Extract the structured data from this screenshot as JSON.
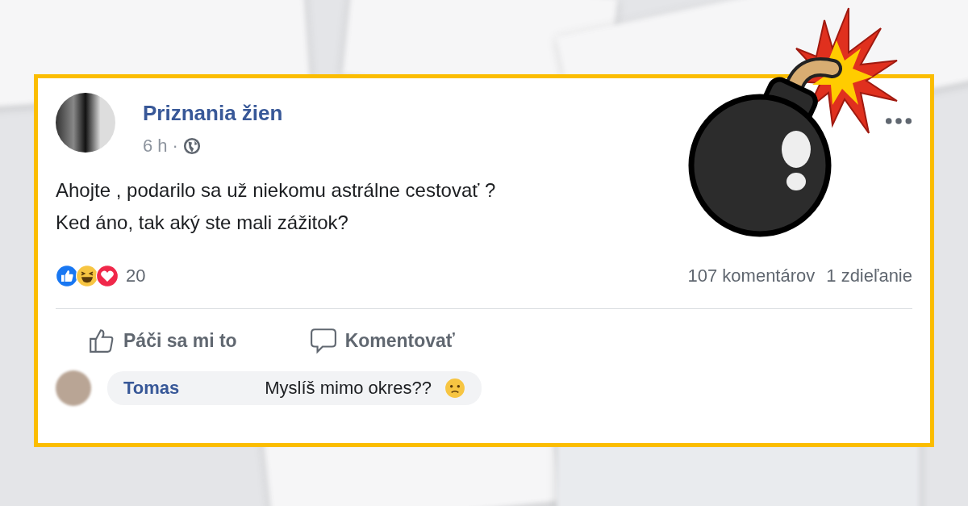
{
  "post": {
    "author": "Priznania žien",
    "time": "6 h",
    "separator": "·",
    "text_lines": [
      "Ahojte , podarilo sa už niekomu astrálne cestovať ?",
      "Ked áno, tak aký ste mali zážitok?"
    ],
    "reactions": [
      {
        "kind": "like"
      },
      {
        "kind": "haha"
      },
      {
        "kind": "love"
      }
    ],
    "reactions_count": "20",
    "comments_count": "107 komentárov",
    "shares_count": "1 zdieľanie",
    "actions": [
      {
        "kind": "like",
        "label": "Páči sa mi to"
      },
      {
        "kind": "comment",
        "label": "Komentovať"
      }
    ],
    "comment": {
      "author": "Tomas",
      "text": "Myslíš mimo okres??"
    }
  }
}
